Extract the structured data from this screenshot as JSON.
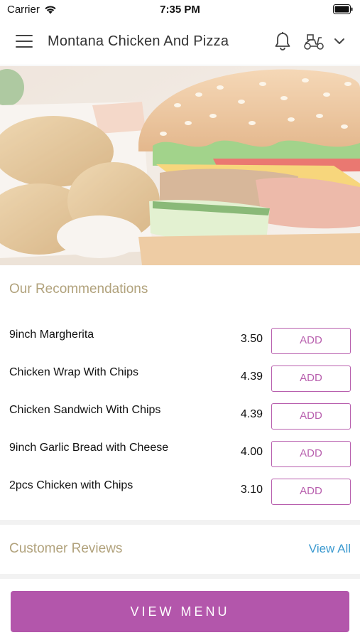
{
  "status_bar": {
    "carrier": "Carrier",
    "time": "7:35 PM"
  },
  "header": {
    "title": "Montana Chicken And Pizza",
    "icons": [
      "menu-icon",
      "bell-icon",
      "scooter-delivery-icon",
      "chevron-down-icon"
    ]
  },
  "hero": {
    "image": "burger-and-fried-chicken-photo"
  },
  "recommendations": {
    "title": "Our Recommendations",
    "items": [
      {
        "name": "9inch Margherita",
        "price": "3.50",
        "add_label": "ADD"
      },
      {
        "name": "Chicken Wrap With Chips",
        "price": "4.39",
        "add_label": "ADD"
      },
      {
        "name": "Chicken Sandwich With Chips",
        "price": "4.39",
        "add_label": "ADD"
      },
      {
        "name": "9inch Garlic Bread with Cheese",
        "price": "4.00",
        "add_label": "ADD"
      },
      {
        "name": "2pcs Chicken with Chips",
        "price": "3.10",
        "add_label": "ADD"
      }
    ]
  },
  "reviews": {
    "title": "Customer Reviews",
    "view_all": "View All"
  },
  "footer": {
    "view_menu": "VIEW MENU"
  },
  "colors": {
    "accent": "#b356ab",
    "section_title": "#b1a27c",
    "link": "#3c9ad0"
  }
}
